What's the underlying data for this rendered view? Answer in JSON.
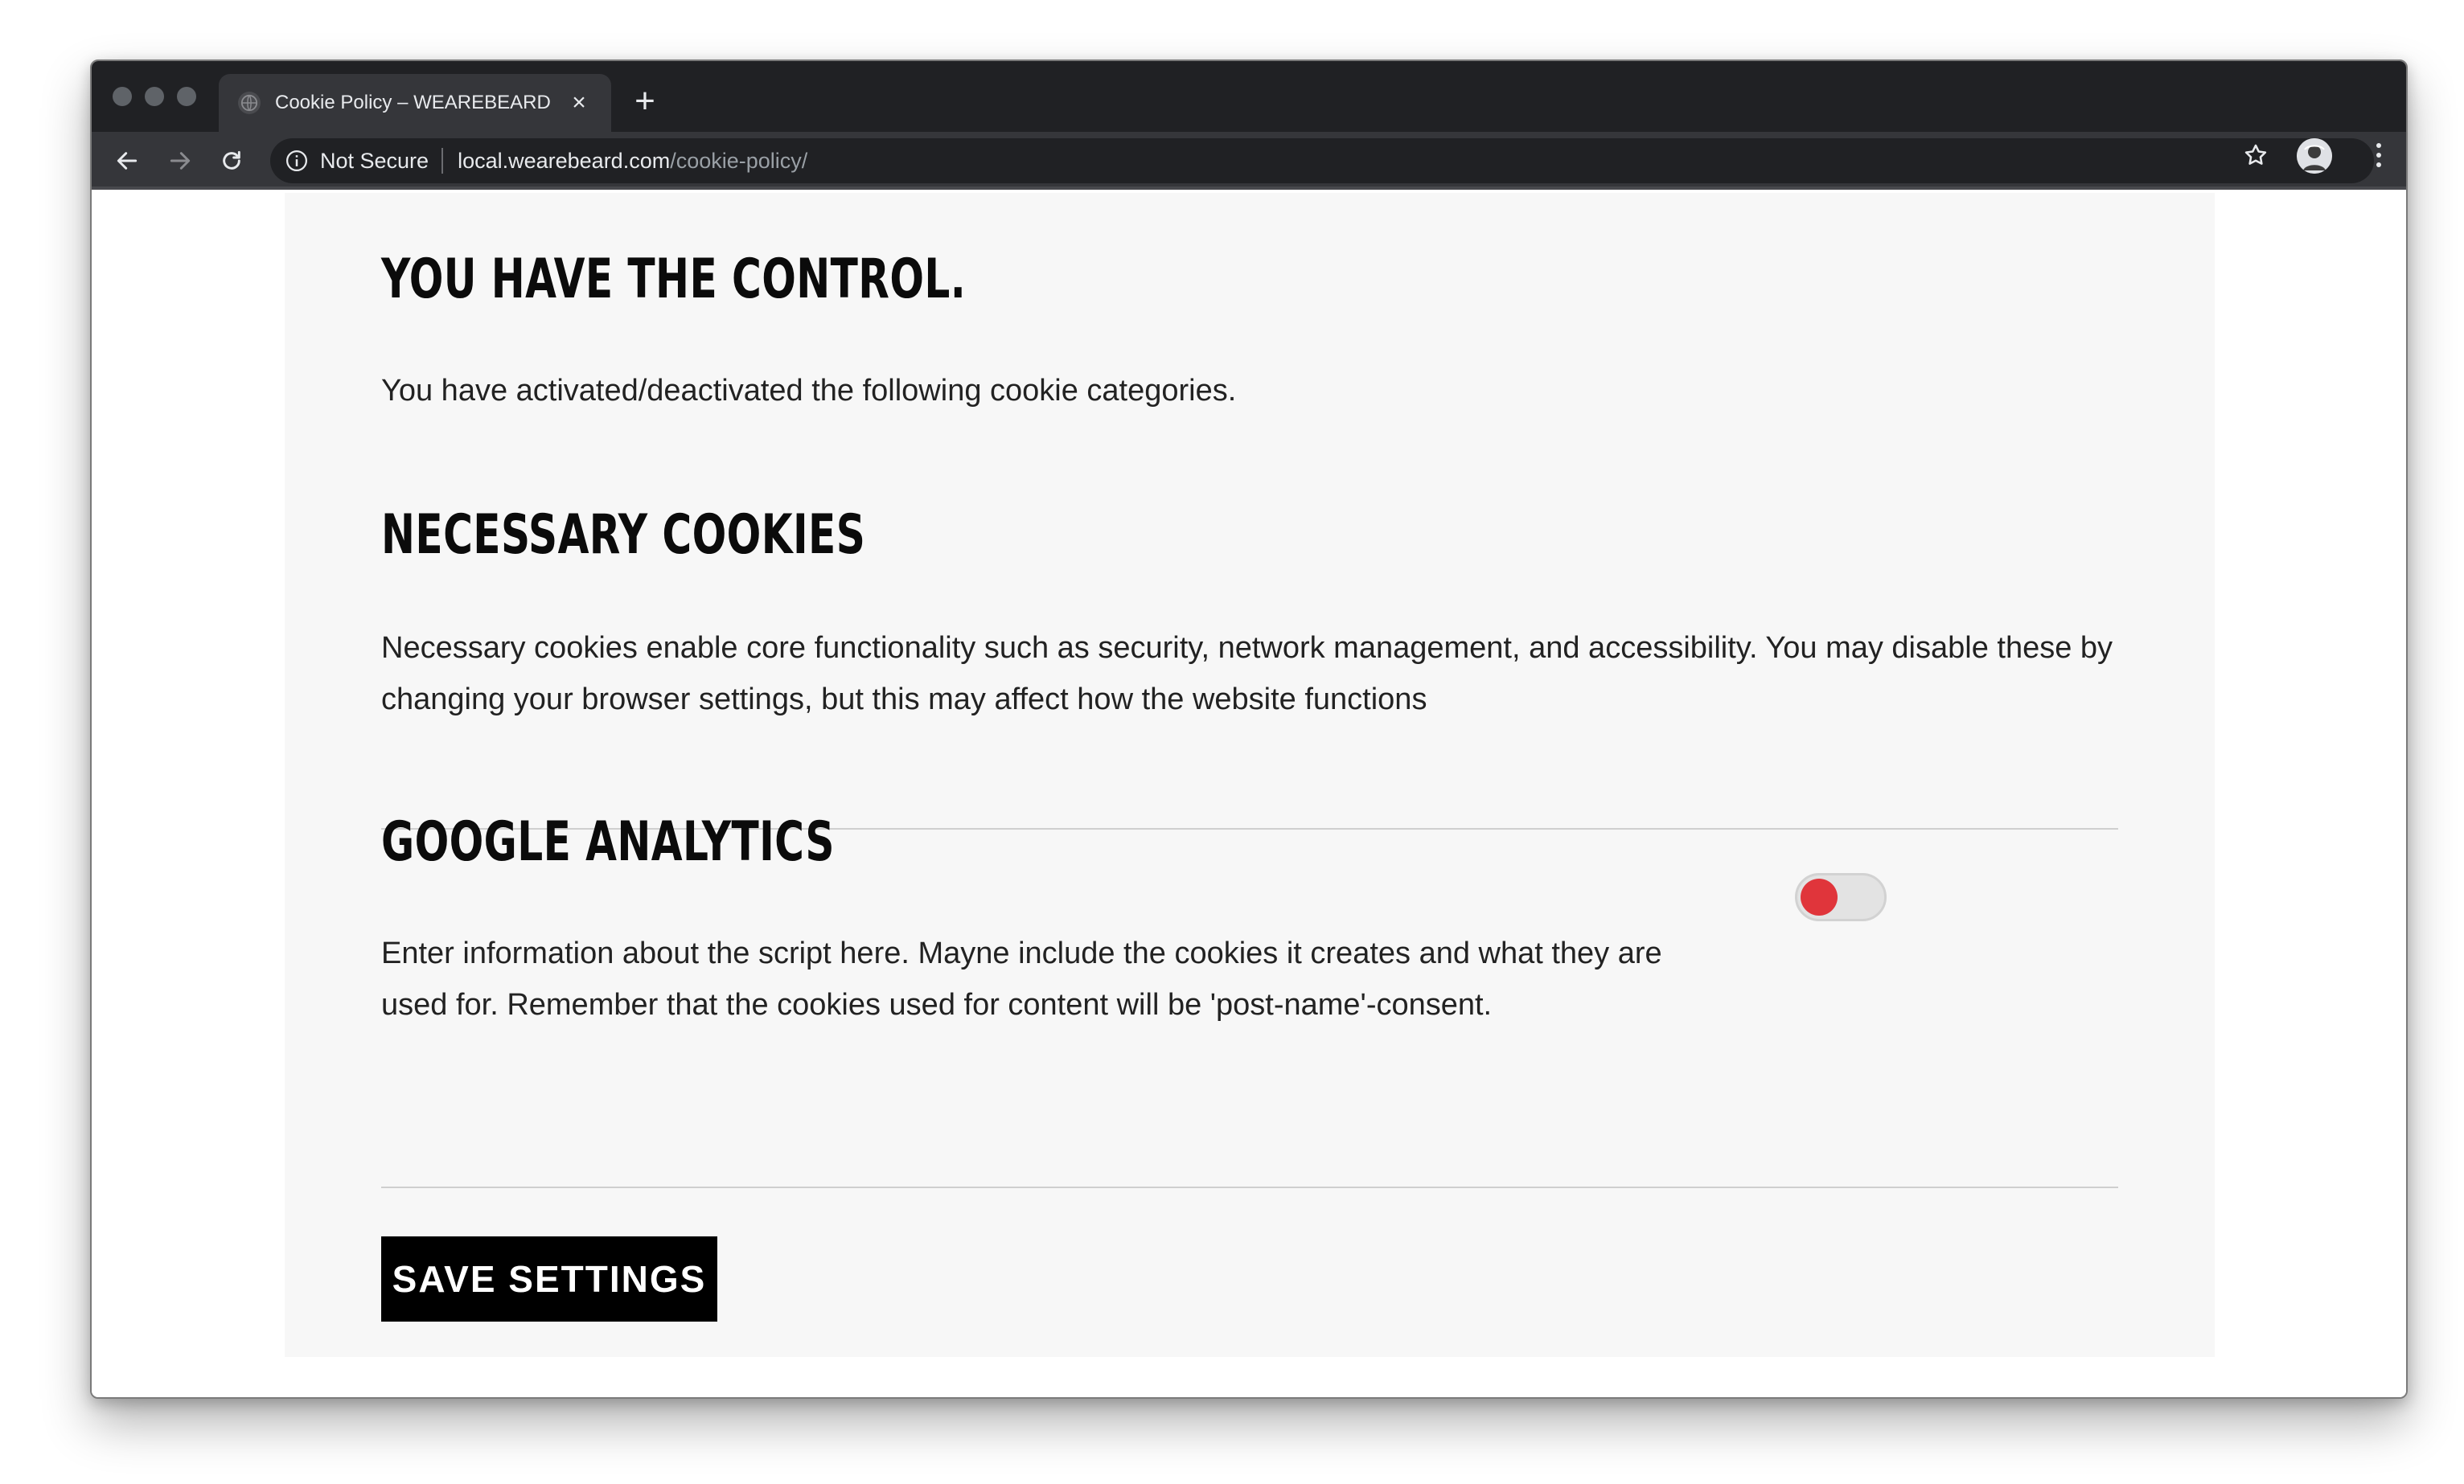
{
  "browser": {
    "tab": {
      "title": "Cookie Policy – WEAREBEARD",
      "close_icon": "×",
      "favicon": "globe-icon"
    },
    "new_tab_icon": "+",
    "security_label": "Not Secure",
    "url_host": "local.wearebeard.com",
    "url_path": "/cookie-policy/"
  },
  "page": {
    "control_heading": "YOU HAVE THE CONTROL.",
    "control_text": "You have activated/deactivated the following cookie categories.",
    "necessary_heading": "NECESSARY COOKIES",
    "necessary_text": "Necessary cookies enable core functionality such as security, network management, and accessibility. You may disable these by changing your browser settings, but this may affect how the website functions",
    "ga_heading": "GOOGLE ANALYTICS",
    "ga_text": "Enter information about the script here. Mayne include the cookies it creates and what they are used for. Remember that the cookies used for content will be 'post-name'-consent.",
    "ga_toggle_state": "off",
    "save_label": "SAVE SETTINGS"
  },
  "colors": {
    "browser_frame": "#202124",
    "toolbar": "#35363a",
    "panel_bg": "#f7f7f7",
    "toggle_knob": "#e0353b",
    "button_bg": "#000000"
  }
}
